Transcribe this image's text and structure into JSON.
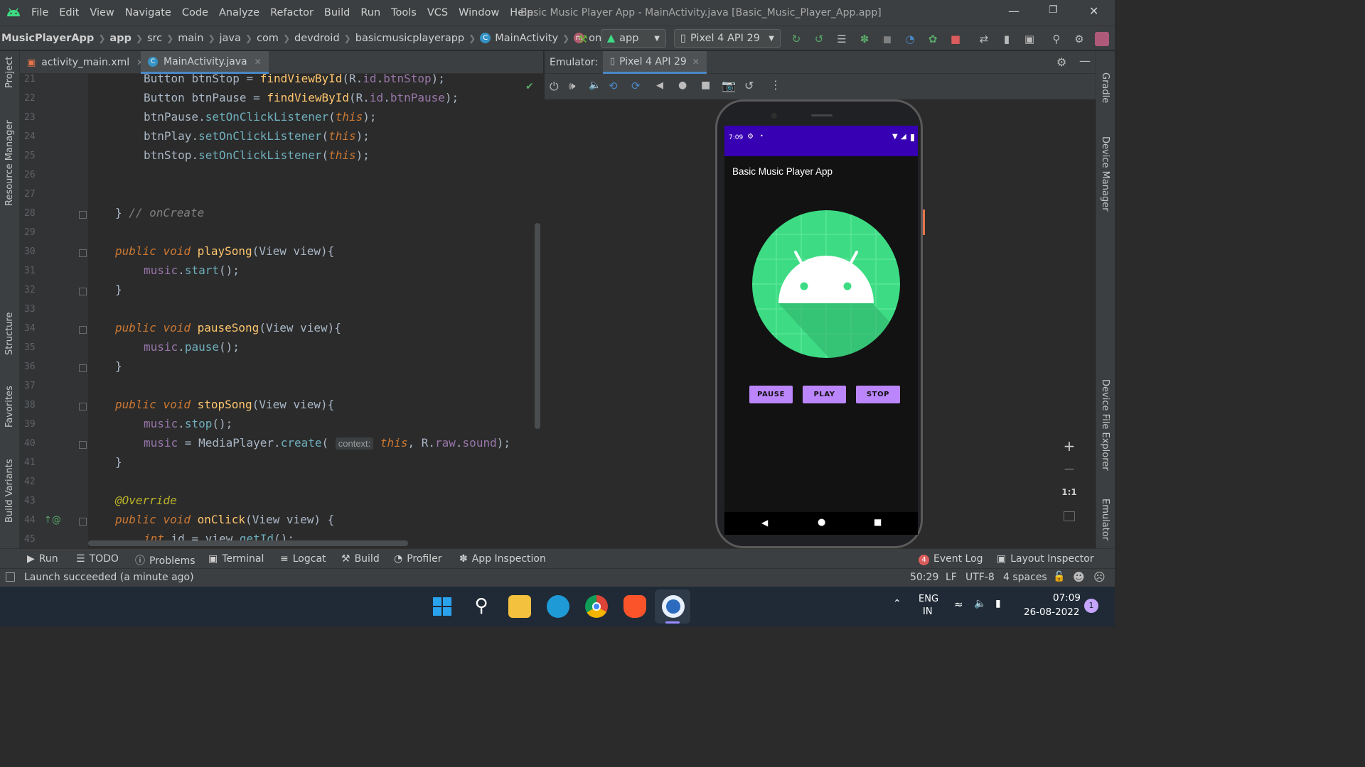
{
  "window": {
    "title": "Basic Music Player App - MainActivity.java [Basic_Music_Player_App.app]",
    "menu": [
      "File",
      "Edit",
      "View",
      "Navigate",
      "Code",
      "Analyze",
      "Refactor",
      "Build",
      "Run",
      "Tools",
      "VCS",
      "Window",
      "Help"
    ]
  },
  "breadcrumb": [
    "MusicPlayerApp",
    "app",
    "src",
    "main",
    "java",
    "com",
    "devdroid",
    "basicmusicplayerapp",
    "MainActivity",
    "onClick"
  ],
  "toolbar": {
    "run_config": "app",
    "device": "Pixel 4 API 29"
  },
  "editor_tabs": [
    {
      "label": "activity_main.xml"
    },
    {
      "label": "MainActivity.java"
    }
  ],
  "left_tools": [
    "Project",
    "Resource Manager",
    "Structure",
    "Favorites",
    "Build Variants"
  ],
  "right_tools": [
    "Gradle",
    "Device Manager",
    "Device File Explorer",
    "Emulator"
  ],
  "code_lines": [
    {
      "n": "21",
      "text": "Button btnStop = findViewById(R.id.btnStop);"
    },
    {
      "n": "22",
      "text": "Button btnPause = findViewById(R.id.btnPause);"
    },
    {
      "n": "23",
      "text": "btnPause.setOnClickListener(this);"
    },
    {
      "n": "24",
      "text": "btnPlay.setOnClickListener(this);"
    },
    {
      "n": "25",
      "text": "btnStop.setOnClickListener(this);"
    },
    {
      "n": "26",
      "text": ""
    },
    {
      "n": "27",
      "text": ""
    },
    {
      "n": "28",
      "text": "} // onCreate"
    },
    {
      "n": "29",
      "text": ""
    },
    {
      "n": "30",
      "text": "public void playSong(View view){"
    },
    {
      "n": "31",
      "text": "music.start();"
    },
    {
      "n": "32",
      "text": "}"
    },
    {
      "n": "33",
      "text": ""
    },
    {
      "n": "34",
      "text": "public void pauseSong(View view){"
    },
    {
      "n": "35",
      "text": "music.pause();"
    },
    {
      "n": "36",
      "text": "}"
    },
    {
      "n": "37",
      "text": ""
    },
    {
      "n": "38",
      "text": "public void stopSong(View view){"
    },
    {
      "n": "39",
      "text": "music.stop();"
    },
    {
      "n": "40",
      "text": "music = MediaPlayer.create( context: this, R.raw.sound);"
    },
    {
      "n": "41",
      "text": "}"
    },
    {
      "n": "42",
      "text": ""
    },
    {
      "n": "43",
      "text": "@Override"
    },
    {
      "n": "44",
      "text": "public void onClick(View view) {"
    },
    {
      "n": "45",
      "text": "int id = view.getId();"
    }
  ],
  "emulator": {
    "label": "Emulator:",
    "tab": "Pixel 4 API 29",
    "zoom_label": "1:1",
    "phone": {
      "time": "7:09",
      "app_title": "Basic Music Player App",
      "buttons": [
        "PAUSE",
        "PLAY",
        "STOP"
      ]
    }
  },
  "bottom_tools": [
    "Run",
    "TODO",
    "Problems",
    "Terminal",
    "Logcat",
    "Build",
    "Profiler",
    "App Inspection"
  ],
  "bottom_right": {
    "event_log_count": "4",
    "event_log": "Event Log",
    "layout_inspector": "Layout Inspector"
  },
  "status": {
    "message": "Launch succeeded (a minute ago)",
    "position": "50:29",
    "line_sep": "LF",
    "encoding": "UTF-8",
    "indent": "4 spaces"
  },
  "taskbar": {
    "lang1": "ENG",
    "lang2": "IN",
    "time": "07:09",
    "date": "26-08-2022",
    "notification_count": "1"
  },
  "colors": {
    "accent": "#4a88c7",
    "phone_status": "#3700b3",
    "phone_button": "#bb86fc",
    "android_green": "#3ddc84"
  }
}
